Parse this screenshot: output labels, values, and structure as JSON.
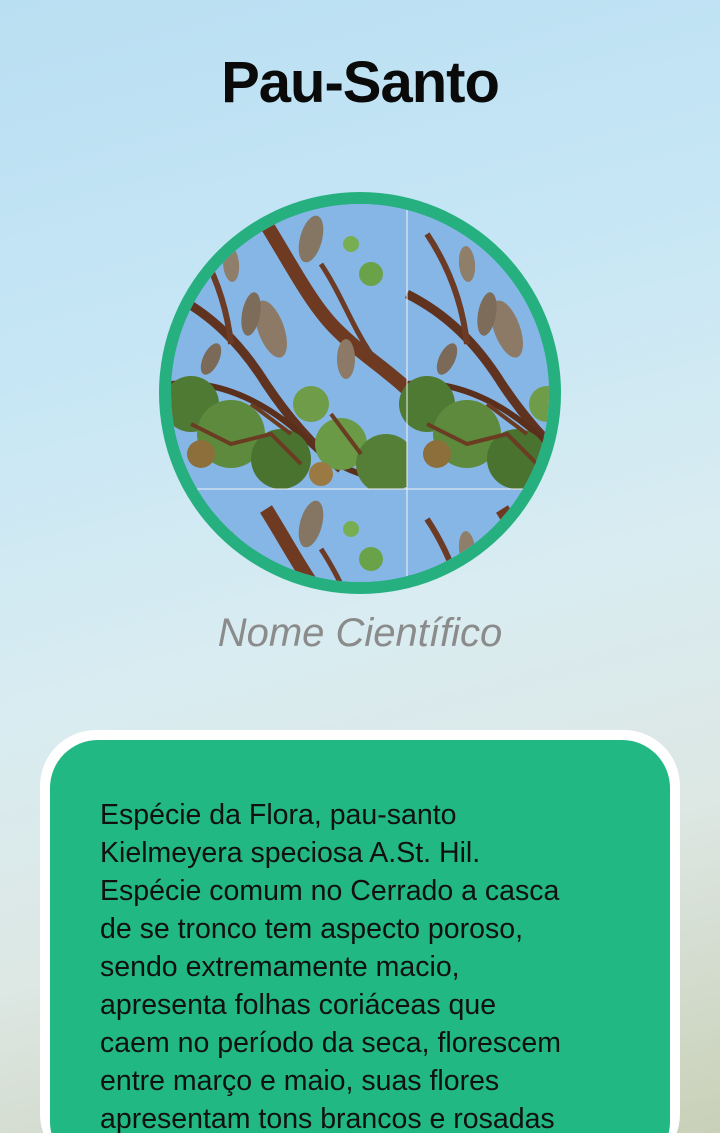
{
  "header": {
    "title": "Pau-Santo"
  },
  "species": {
    "photo_alt": "pau-santo tree branches with seed pods",
    "scientific_name_label": "Nome Científico"
  },
  "description": {
    "text": "Espécie da Flora, pau-santo\nKielmeyera speciosa A.St. Hil.\nEspécie comum no Cerrado a casca\nde se tronco tem aspecto poroso,\nsendo extremamente macio,\napresenta folhas coriáceas que\ncaem no período da seca, florescem\nentre março e maio, suas flores\napresentam tons brancos e rosadas"
  },
  "colors": {
    "accent_green": "#26b07f",
    "card_green": "#21b884",
    "title_text": "#0a0a0a",
    "subtitle_text": "#8b8b8b"
  }
}
